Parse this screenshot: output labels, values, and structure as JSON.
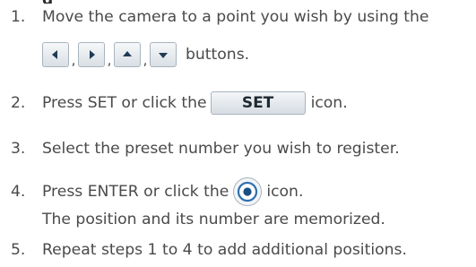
{
  "steps": [
    {
      "number": "1.",
      "text": "Move the camera to a point you wish by using the",
      "text_after_buttons": "buttons.",
      "separator": ",",
      "icons": [
        "left-arrow-icon",
        "right-arrow-icon",
        "up-arrow-icon",
        "down-arrow-icon"
      ]
    },
    {
      "number": "2.",
      "text_before": "Press SET or click the",
      "button_label": "SET",
      "text_after": "icon."
    },
    {
      "number": "3.",
      "text": "Select the preset number you wish to register."
    },
    {
      "number": "4.",
      "text_before": "Press ENTER or click the",
      "icon": "enter-icon",
      "text_after": "icon.",
      "note": "The position and its number are memorized."
    },
    {
      "number": "5.",
      "text": "Repeat steps 1 to 4 to add additional positions."
    }
  ],
  "colors": {
    "text": "#4a4a4a",
    "arrow": "#1f3a55",
    "enter_ring": "#2f6fb0",
    "enter_center": "#1a4f86"
  }
}
